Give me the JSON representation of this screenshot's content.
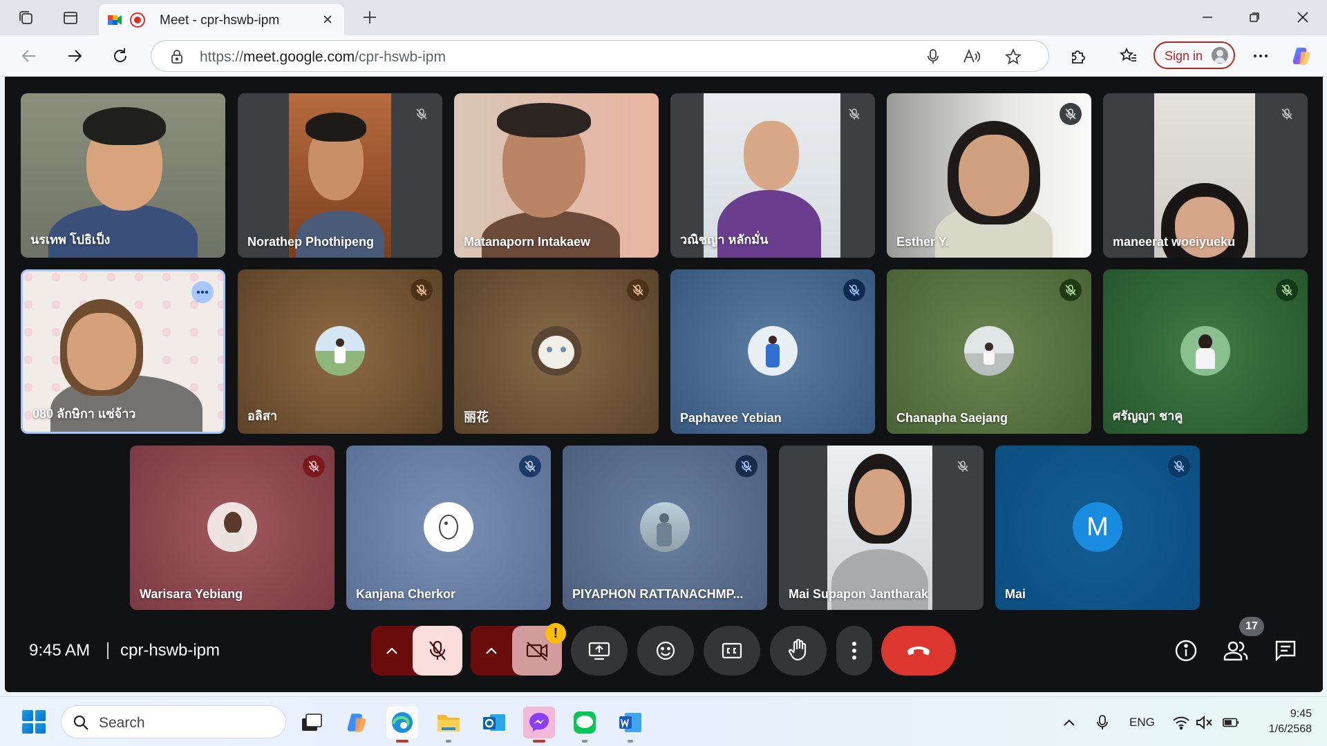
{
  "browser": {
    "tab_title": "Meet - cpr-hswb-ipm",
    "url_scheme": "https://",
    "url_host": "meet.google.com",
    "url_path": "/cpr-hswb-ipm",
    "signin_label": "Sign in"
  },
  "meeting": {
    "time": "9:45 AM",
    "code": "cpr-hswb-ipm",
    "participant_count": "17",
    "camera_warning": "!"
  },
  "participants": [
    {
      "name": "นรเทพ โปธิเป็ง",
      "type": "video",
      "muted": false
    },
    {
      "name": "Norathep Phothipeng",
      "type": "video",
      "muted": true
    },
    {
      "name": "Matanaporn Intakaew",
      "type": "video",
      "muted": false
    },
    {
      "name": "วณิชญา หลักมั่น",
      "type": "video",
      "muted": true
    },
    {
      "name": "Esther Y.",
      "type": "video",
      "muted": true
    },
    {
      "name": "maneerat woeiyueku",
      "type": "video",
      "muted": true
    },
    {
      "name": "080 ลักษิกา แซ่จ้าว",
      "type": "video",
      "muted": false,
      "pinned_menu": true
    },
    {
      "name": "อลิสา",
      "type": "avatar",
      "muted": true
    },
    {
      "name": "丽花",
      "type": "avatar",
      "muted": true
    },
    {
      "name": "Paphavee Yebian",
      "type": "avatar",
      "muted": true
    },
    {
      "name": "Chanapha Saejang",
      "type": "avatar",
      "muted": true
    },
    {
      "name": "ศรัญญา ชาคู",
      "type": "avatar",
      "muted": true
    },
    {
      "name": "Warisara Yebiang",
      "type": "avatar",
      "muted": true
    },
    {
      "name": "Kanjana Cherkor",
      "type": "avatar",
      "muted": true
    },
    {
      "name": "PIYAPHON RATTANACHMP...",
      "type": "avatar",
      "muted": true
    },
    {
      "name": "Mai Supapon Jantharak",
      "type": "video",
      "muted": true
    },
    {
      "name": "Mai",
      "type": "letter",
      "letter": "M",
      "muted": true
    }
  ],
  "taskbar": {
    "search_placeholder": "Search",
    "language": "ENG",
    "clock_time": "9:45",
    "clock_date": "1/6/2568"
  },
  "colors": {
    "meet_bg": "#111214",
    "hangup": "#dc362e",
    "muted_control": "#6b0c0c",
    "mic_off_button": "#f9dedc",
    "cam_off_button": "#d29c9c",
    "warning": "#fbbc04"
  }
}
